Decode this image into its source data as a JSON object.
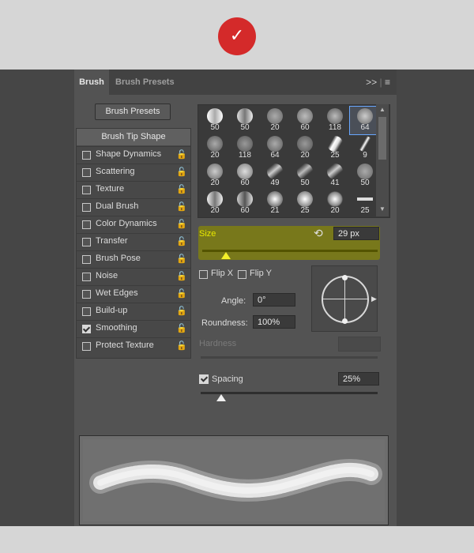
{
  "header": {
    "logo_icon": "vlogo-icon"
  },
  "tabs": [
    {
      "label": "Brush",
      "active": true
    },
    {
      "label": "Brush Presets",
      "active": false
    }
  ],
  "tab_icons": {
    "expand": ">>",
    "menu": "≡"
  },
  "presets_button": {
    "label": "Brush Presets"
  },
  "tip_shape_label": "Brush Tip Shape",
  "options": [
    {
      "label": "Shape Dynamics",
      "checked": false
    },
    {
      "label": "Scattering",
      "checked": false
    },
    {
      "label": "Texture",
      "checked": false
    },
    {
      "label": "Dual Brush",
      "checked": false
    },
    {
      "label": "Color Dynamics",
      "checked": false
    },
    {
      "label": "Transfer",
      "checked": false
    },
    {
      "label": "Brush Pose",
      "checked": false
    },
    {
      "label": "Noise",
      "checked": false
    },
    {
      "label": "Wet Edges",
      "checked": false
    },
    {
      "label": "Build-up",
      "checked": false
    },
    {
      "label": "Smoothing",
      "checked": true
    },
    {
      "label": "Protect Texture",
      "checked": false
    }
  ],
  "brushes": [
    [
      "50",
      "50",
      "20",
      "60",
      "118",
      "64"
    ],
    [
      "20",
      "118",
      "64",
      "20",
      "25",
      "9"
    ],
    [
      "20",
      "60",
      "49",
      "50",
      "41",
      "50"
    ],
    [
      "20",
      "60",
      "21",
      "25",
      "20",
      "25"
    ]
  ],
  "selected_brush": "64",
  "size": {
    "label": "Size",
    "value": "29 px"
  },
  "flip_x": {
    "label": "Flip X",
    "checked": false
  },
  "flip_y": {
    "label": "Flip Y",
    "checked": false
  },
  "angle": {
    "label": "Angle:",
    "value": "0°"
  },
  "roundness": {
    "label": "Roundness:",
    "value": "100%"
  },
  "hardness": {
    "label": "Hardness"
  },
  "spacing": {
    "label": "Spacing",
    "value": "25%",
    "checked": true
  },
  "colors": {
    "panel": "#535353",
    "highlight": "#7f7f12",
    "size_text": "#e8e800",
    "selected_border": "#68a7ff"
  }
}
